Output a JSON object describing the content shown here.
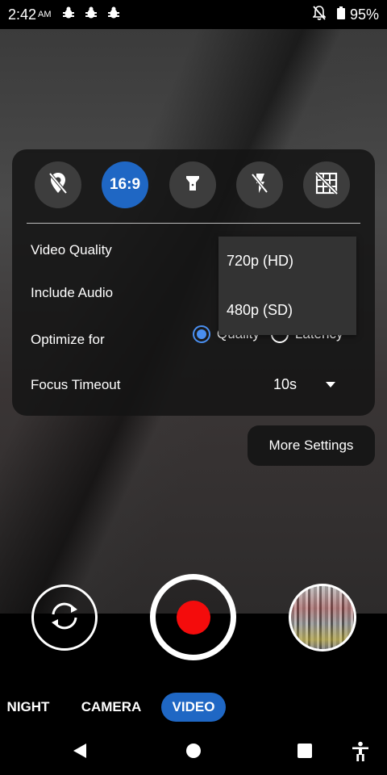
{
  "status_bar": {
    "time": "2:42",
    "ampm": "AM",
    "notification_icons": [
      "bug-icon",
      "bug-icon",
      "bug-icon"
    ],
    "dnd_icon": "notifications-off-icon",
    "battery_icon": "battery-icon",
    "battery": "95%"
  },
  "quick_settings": {
    "icons": [
      "location-off-icon",
      "aspect-ratio",
      "torch-icon",
      "flash-off-icon",
      "grid-off-icon"
    ],
    "aspect_ratio": "16:9",
    "active_color": "#1f67c4",
    "video_quality_label": "Video Quality",
    "include_audio_label": "Include Audio",
    "optimize_label": "Optimize for",
    "optimize_options": [
      "Quality",
      "Latency"
    ],
    "optimize_selected": "Quality",
    "focus_timeout_label": "Focus Timeout",
    "focus_timeout_value": "10s"
  },
  "video_quality_dropdown": {
    "options": [
      "720p (HD)",
      "480p (SD)"
    ]
  },
  "more_settings_label": "More Settings",
  "controls": {
    "switch_camera_icon": "switch-camera-icon",
    "record_color": "#f40c0c",
    "gallery_thumbnail": "last-capture-thumbnail"
  },
  "modes": {
    "items": [
      "NIGHT",
      "CAMERA",
      "VIDEO"
    ],
    "selected": "VIDEO"
  },
  "nav_bar": {
    "icons": [
      "back-icon",
      "home-icon",
      "recents-icon",
      "accessibility-icon"
    ]
  }
}
